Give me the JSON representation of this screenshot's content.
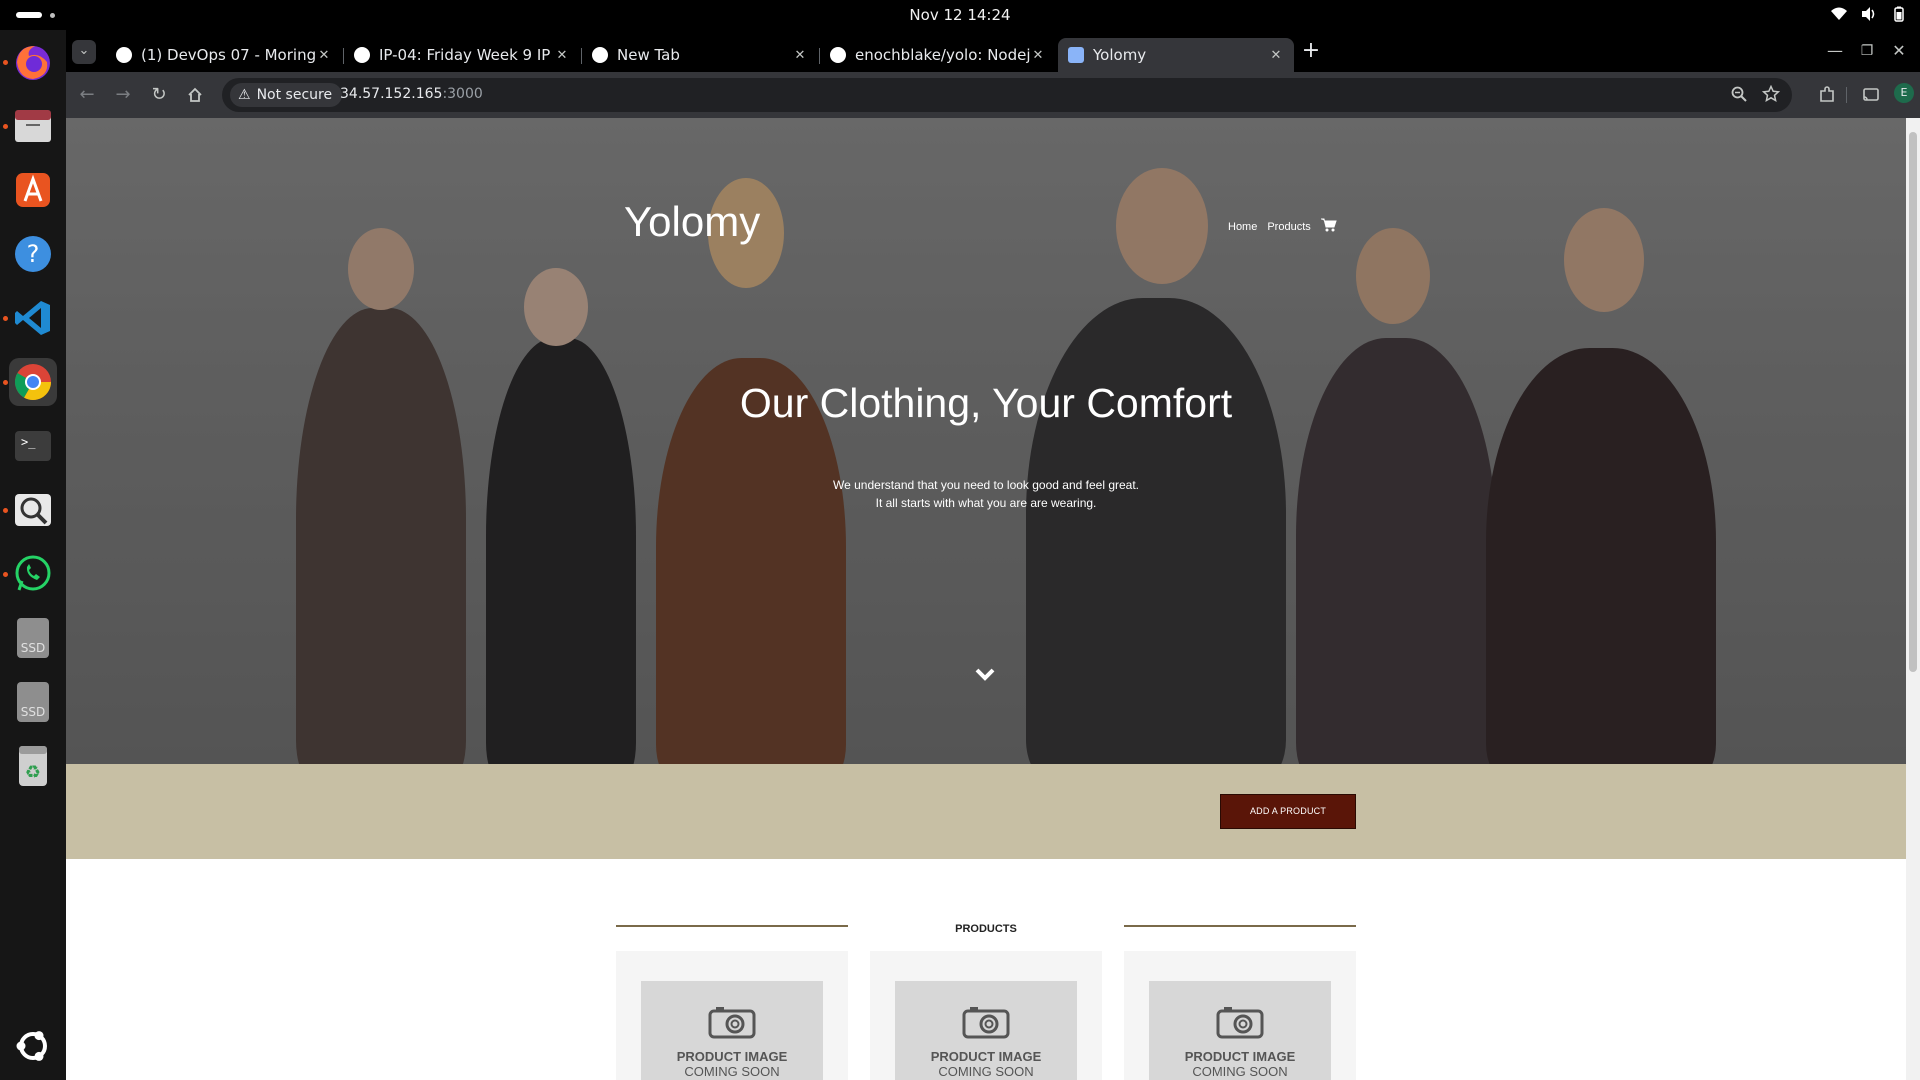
{
  "system": {
    "clock": "Nov 12  14:24"
  },
  "dock": {
    "items": [
      "firefox-icon",
      "files-icon",
      "app-center-icon",
      "help-icon",
      "vscode-icon",
      "chrome-icon",
      "terminal-icon",
      "search-tool-icon",
      "whatsapp-icon",
      "ssd-drive-icon",
      "ssd-drive-icon",
      "trash-icon",
      "ubuntu-apps-icon"
    ],
    "ssd_label": "SSD"
  },
  "browser": {
    "tabs": [
      {
        "title": "(1) DevOps 07 - Moringa",
        "favicon_color": "#ffffff"
      },
      {
        "title": "IP-04: Friday Week 9 IP 4",
        "favicon_color": "#ffffff"
      },
      {
        "title": "New Tab",
        "favicon_color": "#ffffff"
      },
      {
        "title": "enochblake/yolo: Nodejs",
        "favicon_color": "#ffffff"
      },
      {
        "title": "Yolomy",
        "favicon_color": "#8ab4f8"
      }
    ],
    "security_label": "Not secure",
    "url_host": "34.57.152.165",
    "url_port": ":3000",
    "profile_initial": "E"
  },
  "page": {
    "brand": "Yolomy",
    "nav": {
      "home": "Home",
      "products": "Products"
    },
    "hero_title": "Our Clothing, Your Comfort",
    "hero_sub_line1": "We understand that you need to look good and feel great.",
    "hero_sub_line2": "It all starts with what you are are wearing.",
    "add_button": "ADD A PRODUCT",
    "products_heading": "PRODUCTS",
    "product_cards": [
      {
        "line1": "PRODUCT IMAGE",
        "line2": "COMING SOON"
      },
      {
        "line1": "PRODUCT IMAGE",
        "line2": "COMING SOON"
      },
      {
        "line1": "PRODUCT IMAGE",
        "line2": "COMING SOON"
      }
    ]
  },
  "colors": {
    "band": "#c7bfa4",
    "button": "#5a1508",
    "accent_rule": "#7a6a4a"
  }
}
